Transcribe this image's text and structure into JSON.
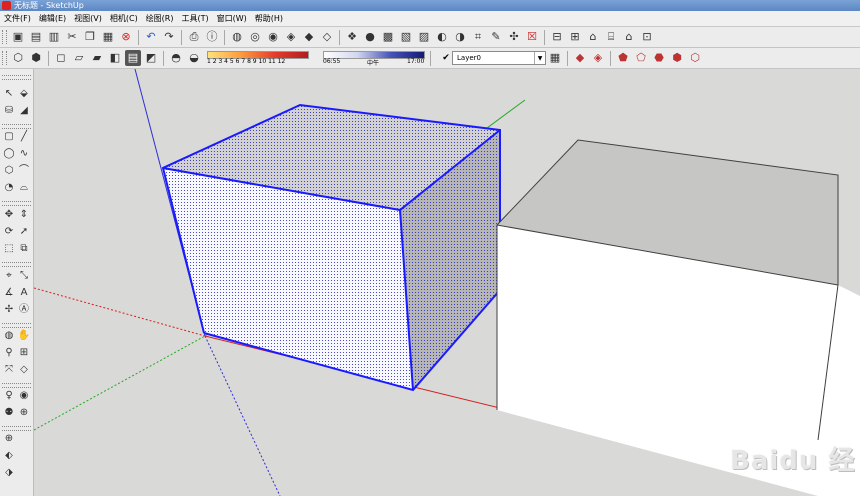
{
  "window": {
    "title": "无标题 - SketchUp"
  },
  "menu": [
    "文件(F)",
    "编辑(E)",
    "视图(V)",
    "相机(C)",
    "绘图(R)",
    "工具(T)",
    "窗口(W)",
    "帮助(H)"
  ],
  "shadow_settings": {
    "date_ticks": "1 2 3 4 5 6 7 8 9 10 11 12",
    "time_start": "06:55",
    "time_mid": "中午",
    "time_end": "17:00"
  },
  "layer": {
    "current": "Layer0"
  },
  "colors": {
    "selection_edge": "#1a1aff",
    "red_axis": "#d42020",
    "green_axis": "#26a826",
    "blue_axis": "#2e2ed6",
    "ground": "#d9d9d7"
  },
  "icons": {
    "toolbar1": [
      "new-file-icon",
      "open-file-icon",
      "save-icon",
      "cut-icon",
      "copy-icon",
      "paste-icon",
      "erase-icon",
      "undo-icon",
      "redo-icon",
      "print-icon",
      "model-info-icon"
    ],
    "views": [
      "iso-view-icon",
      "top-view-icon",
      "front-view-icon",
      "right-view-icon",
      "back-view-icon",
      "left-view-icon"
    ],
    "styles": [
      "xray-icon",
      "wireframe-icon",
      "hidden-line-icon",
      "shaded-icon",
      "shaded-texture-icon",
      "monochrome-icon"
    ]
  },
  "watermark": "Baidu 经"
}
